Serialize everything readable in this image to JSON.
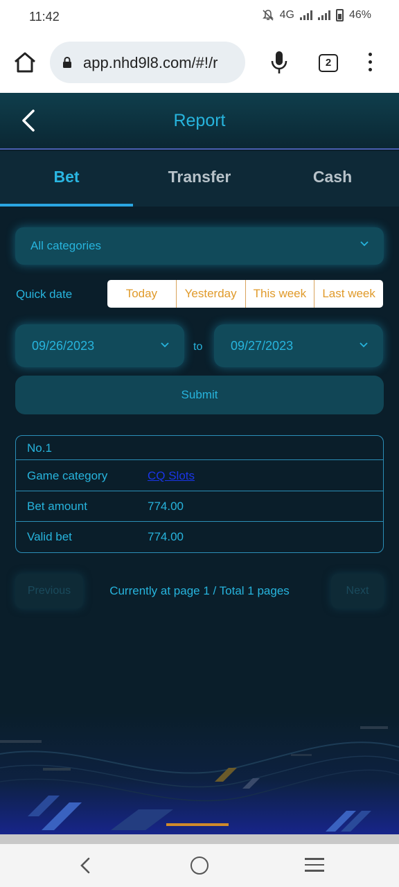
{
  "statusbar": {
    "time": "11:42",
    "network": "4G",
    "battery": "46%"
  },
  "browser": {
    "url": "app.nhd9l8.com/#!/r",
    "tab_count": "2"
  },
  "app": {
    "title": "Report",
    "tabs": [
      {
        "label": "Bet",
        "active": true
      },
      {
        "label": "Transfer",
        "active": false
      },
      {
        "label": "Cash",
        "active": false
      }
    ]
  },
  "filters": {
    "category": "All categories",
    "quick_date_label": "Quick date",
    "quick_dates": [
      "Today",
      "Yesterday",
      "This week",
      "Last week"
    ],
    "from_date": "09/26/2023",
    "to_label": "to",
    "to_date": "09/27/2023",
    "submit_label": "Submit"
  },
  "record": {
    "number": "No.1",
    "rows": [
      {
        "label": "Game category",
        "value": "CQ Slots",
        "is_link": true
      },
      {
        "label": "Bet amount",
        "value": "774.00",
        "is_link": false
      },
      {
        "label": "Valid bet",
        "value": "774.00",
        "is_link": false
      }
    ]
  },
  "pagination": {
    "previous_label": "Previous",
    "info": "Currently at page 1 / Total 1 pages",
    "next_label": "Next"
  },
  "colors": {
    "accent": "#27b4dd",
    "quick_date_text": "#e09a2a",
    "link": "#1a35e8",
    "background": "#0a1e2a"
  },
  "icons": [
    "home-icon",
    "lock-icon",
    "mic-icon",
    "more-vert-icon",
    "back-arrow-icon",
    "chevron-down-icon",
    "nav-back-icon",
    "nav-home-icon",
    "nav-recents-icon"
  ]
}
